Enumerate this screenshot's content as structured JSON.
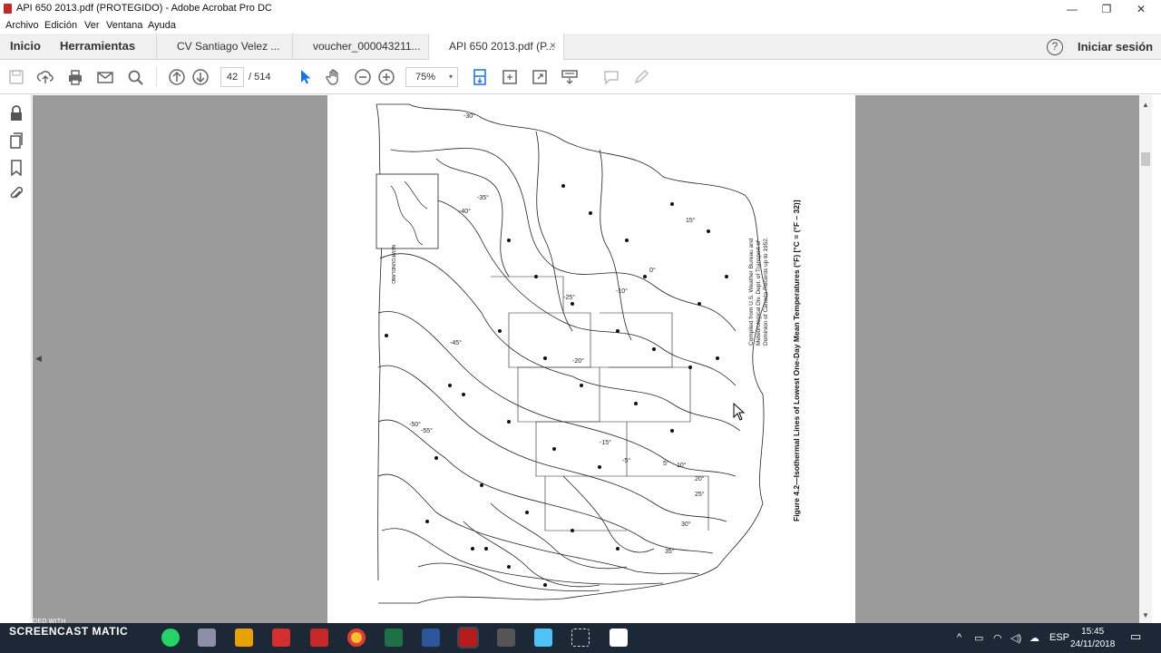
{
  "window": {
    "title": "API 650 2013.pdf (PROTEGIDO) - Adobe Acrobat Pro DC",
    "minimize": "—",
    "restore": "❐",
    "close": "✕"
  },
  "menu": [
    "Archivo",
    "Edición",
    "Ver",
    "Ventana",
    "Ayuda"
  ],
  "nav": {
    "home": "Inicio",
    "tools": "Herramientas"
  },
  "tabs": [
    {
      "label": "CV Santiago Velez ..."
    },
    {
      "label": "voucher_000043211..."
    },
    {
      "label": "API 650 2013.pdf (P...",
      "close": "×"
    }
  ],
  "header": {
    "help": "?",
    "signin": "Iniciar sesión"
  },
  "toolbar": {
    "page_current": "42",
    "page_total": "/ 514",
    "zoom": "75%",
    "zoom_caret": "▾"
  },
  "document": {
    "figure_caption": "Figure 4.2—Isothermal Lines of Lowest One-Day Mean Temperatures (°F) [°C = (°F – 32)]",
    "source_note_1": "Compiled from U.S. Weather Bureau and",
    "source_note_2": "Meteorological Div. Dept. of Transport of",
    "source_note_3": "Dominion of Canada Records up to 1952.",
    "inset_label": "NEWFOUNDLAND",
    "isotherm_labels": [
      "-30°",
      "-35°",
      "-40°",
      "-45°",
      "-50°",
      "-55°",
      "-25°",
      "-20°",
      "-15°",
      "-10°",
      "-5°",
      "0°",
      "5°",
      "10°",
      "15°",
      "20°",
      "25°",
      "30°",
      "35°"
    ]
  },
  "watermark": {
    "line1": "RECORDED WITH",
    "line2": "SCREENCAST",
    "line3": "MATIC"
  },
  "tray": {
    "lang": "ESP",
    "time": "15:45",
    "date": "24/11/2018"
  }
}
